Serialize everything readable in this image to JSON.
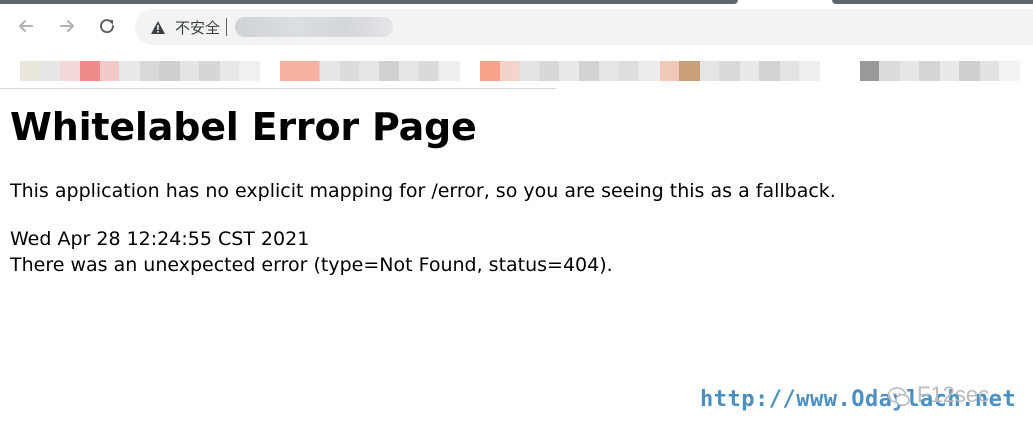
{
  "browser": {
    "security_label": "不安全",
    "address_separator": "|"
  },
  "icons": {
    "back": "arrow-left-icon",
    "forward": "arrow-right-icon",
    "reload": "reload-icon",
    "security": "warning-triangle-icon"
  },
  "page": {
    "heading": "Whitelabel Error Page",
    "message": "This application has no explicit mapping for /error, so you are seeing this as a fallback.",
    "timestamp": "Wed Apr 28 12:24:55 CST 2021",
    "error_detail": "There was an unexpected error (type=Not Found, status=404)."
  },
  "watermark": {
    "url_text": "http://www.Odaylach.net",
    "brand_text": "F12sec"
  },
  "colors": {
    "watermark_url": "#4a90c2",
    "omnibox_bg": "#f1f3f4",
    "text": "#000000"
  }
}
